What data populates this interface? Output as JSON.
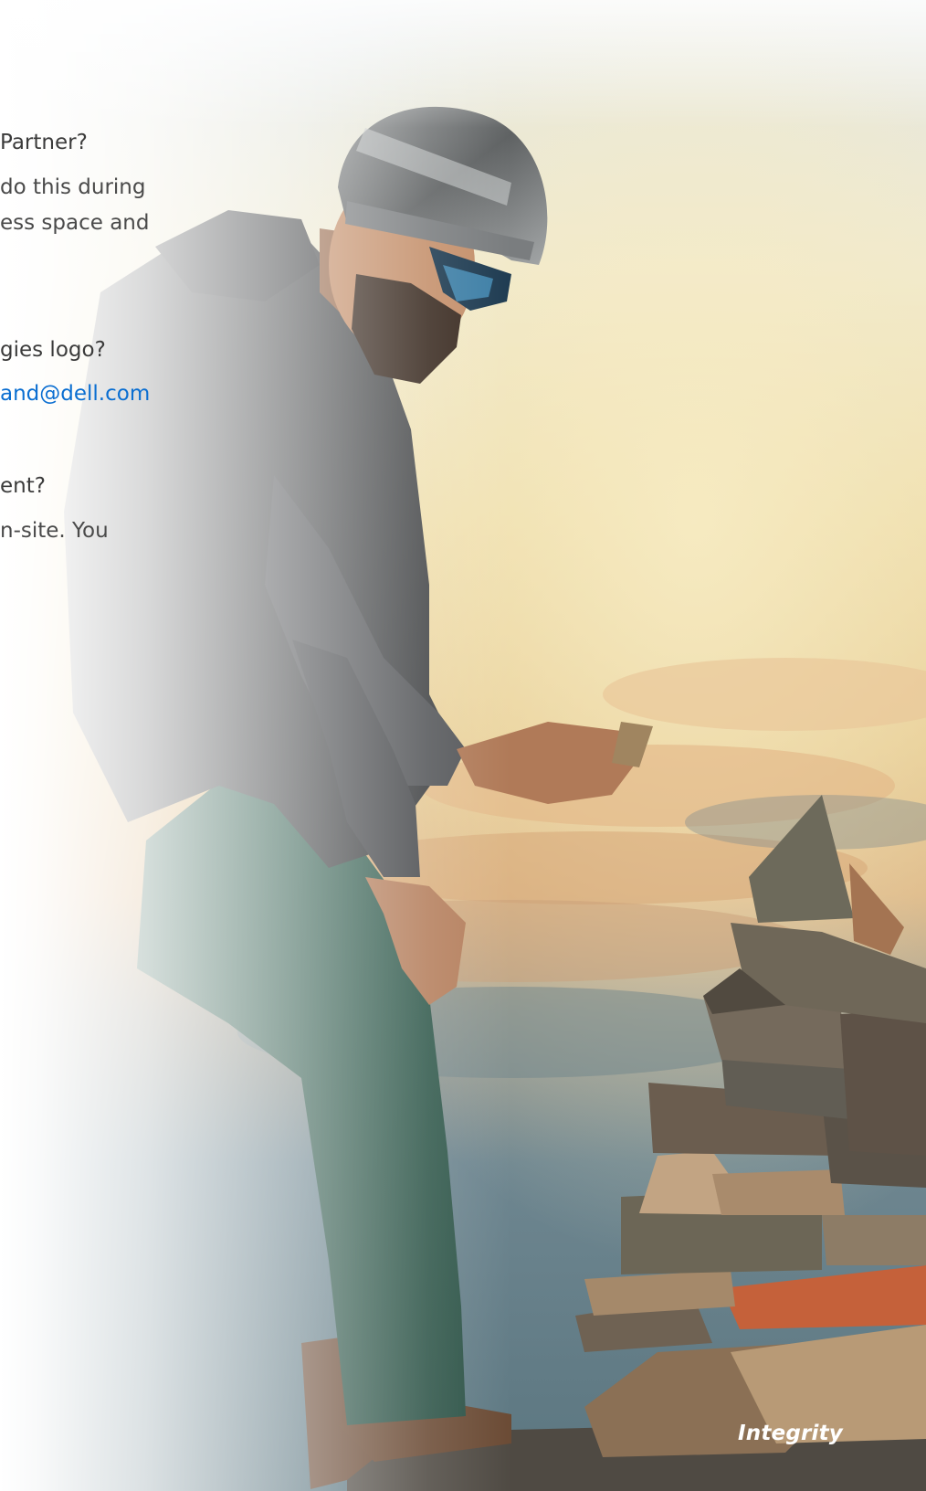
{
  "faq": {
    "q1": "Partner?",
    "a1_line1": "do this during",
    "a1_line2": "ess space and",
    "q2": "gies logo?",
    "a2_link": "and@dell.com",
    "q3": "ent?",
    "a3_line1": "n-site. You"
  },
  "hero": {
    "caption": "Integrity",
    "image_description_icon": "hiker-cairn-photo"
  },
  "colors": {
    "link": "#0a6ed1",
    "text": "#444444",
    "caption": "#ffffff"
  }
}
